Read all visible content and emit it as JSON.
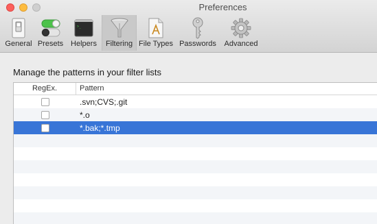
{
  "window": {
    "title": "Preferences"
  },
  "toolbar": {
    "items": [
      {
        "label": "General",
        "icon": "switch-icon"
      },
      {
        "label": "Presets",
        "icon": "toggles-icon"
      },
      {
        "label": "Helpers",
        "icon": "terminal-icon"
      },
      {
        "label": "Filtering",
        "icon": "funnel-icon",
        "selected": true
      },
      {
        "label": "File Types",
        "icon": "document-icon"
      },
      {
        "label": "Passwords",
        "icon": "key-icon"
      },
      {
        "label": "Advanced",
        "icon": "gear-icon"
      }
    ]
  },
  "main": {
    "heading": "Manage the patterns in your filter lists",
    "table": {
      "columns": {
        "regex": "RegEx.",
        "pattern": "Pattern"
      },
      "rows": [
        {
          "regex": false,
          "pattern": ".svn;CVS;.git"
        },
        {
          "regex": false,
          "pattern": "*.o"
        },
        {
          "regex": false,
          "pattern": "*.bak;*.tmp",
          "selected": true
        }
      ]
    }
  },
  "colors": {
    "selection": "#3875d7",
    "alt_row": "#f3f5f8"
  }
}
